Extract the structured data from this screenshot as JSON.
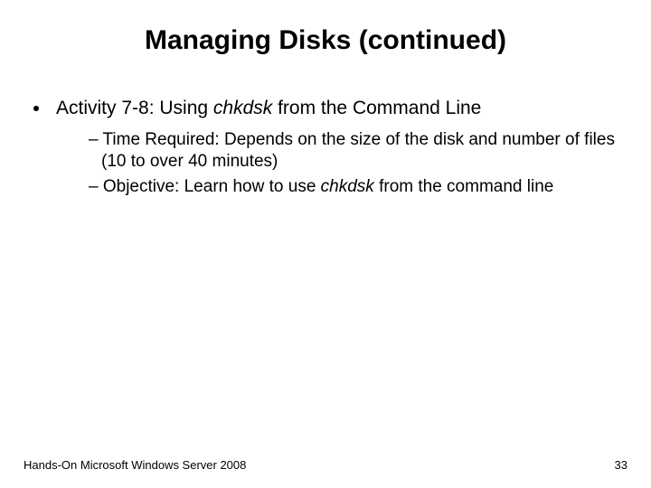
{
  "title": "Managing Disks (continued)",
  "bullet1_pre": "Activity 7-8: Using ",
  "bullet1_em": "chkdsk",
  "bullet1_post": " from the Command Line",
  "sub1": "Time Required: Depends on the size of the disk and number of files (10 to over 40 minutes)",
  "sub2_pre": "Objective: Learn how to use ",
  "sub2_em": "chkdsk",
  "sub2_post": " from the command line",
  "footer": "Hands-On Microsoft Windows Server 2008",
  "page": "33"
}
